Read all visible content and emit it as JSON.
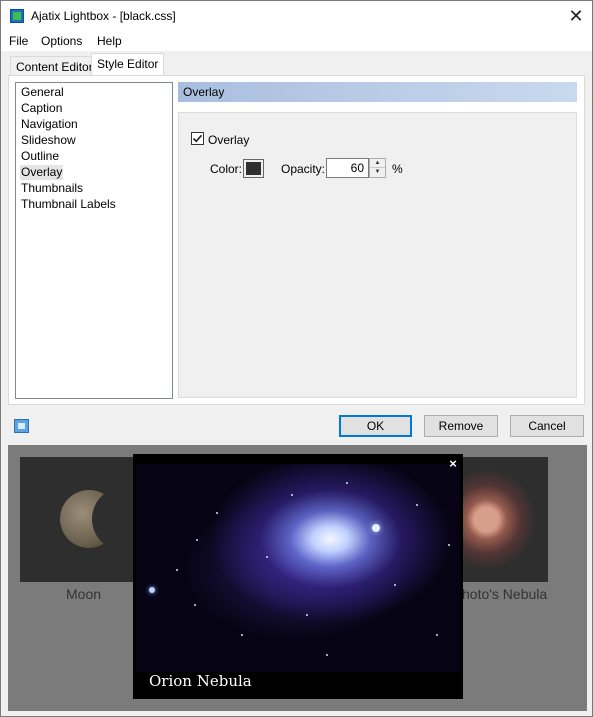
{
  "window": {
    "title": "Ajatix Lightbox - [black.css]",
    "close_symbol": "✕"
  },
  "menu": [
    "File",
    "Options",
    "Help"
  ],
  "tabs": [
    {
      "label": "Content Editor",
      "active": false
    },
    {
      "label": "Style Editor",
      "active": true
    }
  ],
  "sidebar": {
    "items": [
      "General",
      "Caption",
      "Navigation",
      "Slideshow",
      "Outline",
      "Overlay",
      "Thumbnails",
      "Thumbnail Labels"
    ],
    "selected": "Overlay"
  },
  "panel": {
    "header": "Overlay",
    "overlay_checkbox": {
      "label": "Overlay",
      "checked": true
    },
    "color": {
      "label": "Color:",
      "value": "#303030"
    },
    "opacity": {
      "label": "Opacity:",
      "value": "60",
      "unit": "%"
    }
  },
  "buttons": {
    "ok": "OK",
    "remove": "Remove",
    "cancel": "Cancel"
  },
  "preview": {
    "thumbnails": [
      {
        "caption": "Moon"
      },
      {
        "caption": "hoto's Nebula"
      }
    ],
    "lightbox": {
      "caption": "Orion Nebula",
      "close_symbol": "×"
    }
  }
}
